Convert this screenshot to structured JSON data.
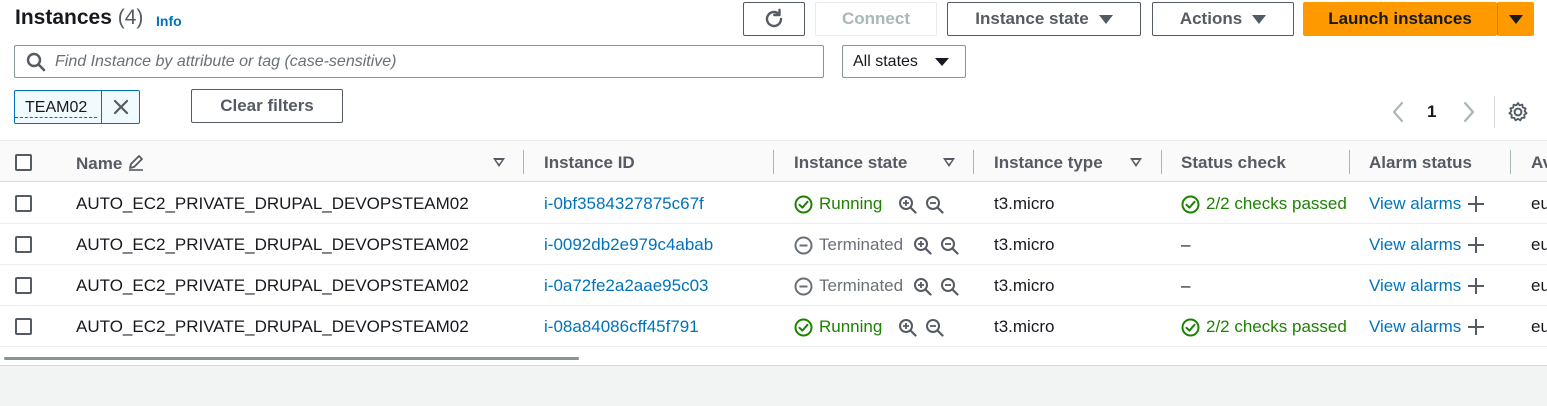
{
  "header": {
    "title": "Instances",
    "count": "(4)",
    "info": "Info"
  },
  "toolbar": {
    "connect": "Connect",
    "instance_state": "Instance state",
    "actions": "Actions",
    "launch": "Launch instances"
  },
  "search": {
    "placeholder": "Find Instance by attribute or tag (case-sensitive)"
  },
  "filter": {
    "state_select": "All states",
    "token": "TEAM02",
    "clear": "Clear filters"
  },
  "pagination": {
    "page": "1"
  },
  "columns": {
    "name": "Name",
    "instance_id": "Instance ID",
    "instance_state": "Instance state",
    "instance_type": "Instance type",
    "status_check": "Status check",
    "alarm_status": "Alarm status",
    "availability_zone_partial": "Av"
  },
  "rows": [
    {
      "name": "AUTO_EC2_PRIVATE_DRUPAL_DEVOPSTEAM02",
      "id": "i-0bf3584327875c67f",
      "state": "Running",
      "type": "t3.micro",
      "status": "2/2 checks passed",
      "alarm": "View alarms",
      "az": "eu"
    },
    {
      "name": "AUTO_EC2_PRIVATE_DRUPAL_DEVOPSTEAM02",
      "id": "i-0092db2e979c4abab",
      "state": "Terminated",
      "type": "t3.micro",
      "status": "–",
      "alarm": "View alarms",
      "az": "eu"
    },
    {
      "name": "AUTO_EC2_PRIVATE_DRUPAL_DEVOPSTEAM02",
      "id": "i-0a72fe2a2aae95c03",
      "state": "Terminated",
      "type": "t3.micro",
      "status": "–",
      "alarm": "View alarms",
      "az": "eu"
    },
    {
      "name": "AUTO_EC2_PRIVATE_DRUPAL_DEVOPSTEAM02",
      "id": "i-08a84086cff45f791",
      "state": "Running",
      "type": "t3.micro",
      "status": "2/2 checks passed",
      "alarm": "View alarms",
      "az": "eu"
    }
  ],
  "colors": {
    "accent": "#ff9900",
    "link": "#0073bb",
    "success": "#1d8102",
    "muted": "#687078"
  }
}
